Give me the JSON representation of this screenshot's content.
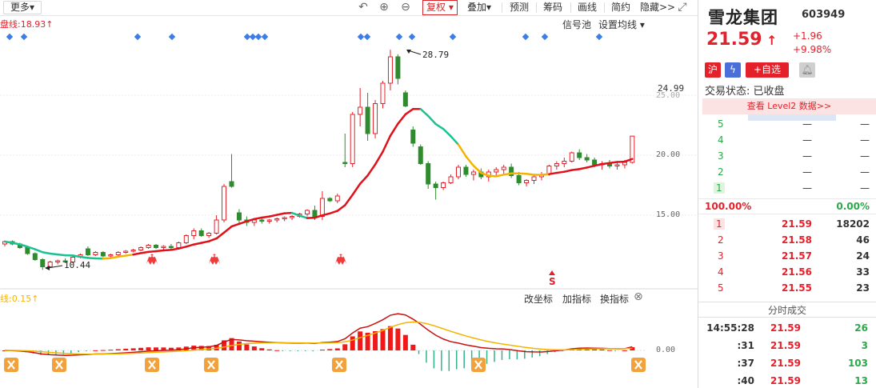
{
  "toolbar": {
    "more": "更多",
    "undo_icon": "undo-icon",
    "zoom_in_icon": "zoom-in-icon",
    "zoom_out_icon": "zoom-out-icon",
    "fuquan": "复权",
    "diejia": "叠加",
    "yuce": "预测",
    "chouma": "筹码",
    "huaxian": "画线",
    "jianyue": "简约",
    "hide": "隐藏>>"
  },
  "overlay": {
    "ma_label": "盘线:18.93",
    "signal_pool": "信号池",
    "set_ma": "设置均线",
    "high_label": "28.79",
    "low_label": "10.44",
    "s_mark": "S",
    "indicator_label": "线:0.15",
    "change_coord": "改坐标",
    "add_indicator": "加指标",
    "switch_indicator": "换指标"
  },
  "axis": {
    "last_close_tag": "24.99",
    "ticks": [
      "25.00",
      "20.00",
      "15.00"
    ],
    "macd_zero": "0.00"
  },
  "colors": {
    "up": "#e4212b",
    "down": "#2e8b2e",
    "ma_red": "#e0111b",
    "ma_green": "#1bc291",
    "ma_yellow": "#f3b400",
    "signal_blue": "#3d7de8"
  },
  "chart_data": {
    "type": "candlestick",
    "price_axis_ticks": [
      15,
      20,
      25
    ],
    "last_price_tag": 24.99,
    "high": 28.79,
    "low": 10.44,
    "candles": [
      [
        12.6,
        12.9,
        12.4,
        12.8
      ],
      [
        12.8,
        12.9,
        12.5,
        12.6
      ],
      [
        12.6,
        12.7,
        12.2,
        12.3
      ],
      [
        12.3,
        12.4,
        11.7,
        11.8
      ],
      [
        11.8,
        11.9,
        11.2,
        11.3
      ],
      [
        11.3,
        11.4,
        10.44,
        10.7
      ],
      [
        10.7,
        11.2,
        10.6,
        11.1
      ],
      [
        11.1,
        11.3,
        10.9,
        11.2
      ],
      [
        11.2,
        11.4,
        11.0,
        11.1
      ],
      [
        11.1,
        11.6,
        11.0,
        11.5
      ],
      [
        11.5,
        11.8,
        11.4,
        11.7
      ],
      [
        12.2,
        12.4,
        11.6,
        11.7
      ],
      [
        11.7,
        12.0,
        11.6,
        11.9
      ],
      [
        11.9,
        12.0,
        11.5,
        11.6
      ],
      [
        11.6,
        11.8,
        11.5,
        11.7
      ],
      [
        11.7,
        12.0,
        11.6,
        11.9
      ],
      [
        11.9,
        12.1,
        11.8,
        12.0
      ],
      [
        12.0,
        12.2,
        11.9,
        12.1
      ],
      [
        12.1,
        12.4,
        12.0,
        12.3
      ],
      [
        12.3,
        12.6,
        12.2,
        12.5
      ],
      [
        12.5,
        12.6,
        12.2,
        12.3
      ],
      [
        12.3,
        12.5,
        12.1,
        12.4
      ],
      [
        12.4,
        12.6,
        12.2,
        12.3
      ],
      [
        12.3,
        12.8,
        12.3,
        12.7
      ],
      [
        12.7,
        13.4,
        12.6,
        13.3
      ],
      [
        13.3,
        13.9,
        13.0,
        13.7
      ],
      [
        13.7,
        13.9,
        13.2,
        13.3
      ],
      [
        13.3,
        13.6,
        13.1,
        13.5
      ],
      [
        13.5,
        15.0,
        13.4,
        14.6
      ],
      [
        14.6,
        17.6,
        14.4,
        17.4
      ],
      [
        17.8,
        20.1,
        17.3,
        17.4
      ],
      [
        15.2,
        15.5,
        14.3,
        14.6
      ],
      [
        14.6,
        14.9,
        14.1,
        14.4
      ],
      [
        14.4,
        14.7,
        14.1,
        14.6
      ],
      [
        14.6,
        14.8,
        14.3,
        14.5
      ],
      [
        14.5,
        14.7,
        14.3,
        14.6
      ],
      [
        14.6,
        14.8,
        14.4,
        14.7
      ],
      [
        14.7,
        14.9,
        14.5,
        14.8
      ],
      [
        14.8,
        15.0,
        14.6,
        14.9
      ],
      [
        14.9,
        15.2,
        14.8,
        15.1
      ],
      [
        15.1,
        15.5,
        14.9,
        15.4
      ],
      [
        15.4,
        15.8,
        14.6,
        14.9
      ],
      [
        14.9,
        17.0,
        14.6,
        16.4
      ],
      [
        16.4,
        16.5,
        16.1,
        16.2
      ],
      [
        16.2,
        16.8,
        16.0,
        16.6
      ],
      [
        19.4,
        21.8,
        19.0,
        19.3
      ],
      [
        19.3,
        23.6,
        19.0,
        23.4
      ],
      [
        23.4,
        25.6,
        22.4,
        24.0
      ],
      [
        24.0,
        25.2,
        21.2,
        21.8
      ],
      [
        21.8,
        24.6,
        21.4,
        24.3
      ],
      [
        24.3,
        26.2,
        23.9,
        26.0
      ],
      [
        26.0,
        28.79,
        25.4,
        28.2
      ],
      [
        28.2,
        28.4,
        25.9,
        26.4
      ],
      [
        25.2,
        25.4,
        24.0,
        24.1
      ],
      [
        22.1,
        22.4,
        20.7,
        21.0
      ],
      [
        20.7,
        20.9,
        19.2,
        19.3
      ],
      [
        19.3,
        19.5,
        17.2,
        17.6
      ],
      [
        17.6,
        17.8,
        16.3,
        17.3
      ],
      [
        17.3,
        17.8,
        17.1,
        17.7
      ],
      [
        17.7,
        18.4,
        17.6,
        18.2
      ],
      [
        18.2,
        19.2,
        18.0,
        19.0
      ],
      [
        19.0,
        19.2,
        18.2,
        18.4
      ],
      [
        18.4,
        18.8,
        17.9,
        18.6
      ],
      [
        18.6,
        18.9,
        18.0,
        18.2
      ],
      [
        18.2,
        18.8,
        17.8,
        18.6
      ],
      [
        18.6,
        19.0,
        18.2,
        18.8
      ],
      [
        18.8,
        19.2,
        18.4,
        19.0
      ],
      [
        19.0,
        19.3,
        18.1,
        18.3
      ],
      [
        18.3,
        18.6,
        17.5,
        17.7
      ],
      [
        17.7,
        18.0,
        17.4,
        17.9
      ],
      [
        17.9,
        18.4,
        17.6,
        18.2
      ],
      [
        18.2,
        18.6,
        17.9,
        18.4
      ],
      [
        18.4,
        19.2,
        18.3,
        19.1
      ],
      [
        19.1,
        19.5,
        18.8,
        19.3
      ],
      [
        19.3,
        19.8,
        19.0,
        19.5
      ],
      [
        19.5,
        20.3,
        19.4,
        20.2
      ],
      [
        20.2,
        20.5,
        19.6,
        19.8
      ],
      [
        19.8,
        20.1,
        19.4,
        19.6
      ],
      [
        19.6,
        19.8,
        19.0,
        19.2
      ],
      [
        19.2,
        19.5,
        18.8,
        19.3
      ],
      [
        19.3,
        19.6,
        18.9,
        19.1
      ],
      [
        19.1,
        19.4,
        18.8,
        19.2
      ],
      [
        19.2,
        19.6,
        18.9,
        19.4
      ],
      [
        19.4,
        21.59,
        19.3,
        21.59
      ]
    ]
  },
  "quote": {
    "name": "雪龙集团",
    "code": "603949",
    "price": "21.59",
    "change": "+1.96",
    "change_pct": "+9.98%",
    "market_badge": "沪",
    "add_watch": "+自选",
    "trade_status": "交易状态: 已收盘",
    "level2": "查看 Level2 数据>>",
    "ask_dash": "—",
    "ratio_left": "100.00%",
    "ratio_right": "0.00%",
    "asks": [
      {
        "level": "5",
        "price": "—",
        "vol": "—"
      },
      {
        "level": "4",
        "price": "—",
        "vol": "—"
      },
      {
        "level": "3",
        "price": "—",
        "vol": "—"
      },
      {
        "level": "2",
        "price": "—",
        "vol": "—"
      },
      {
        "level": "1",
        "price": "—",
        "vol": "—"
      }
    ],
    "bids": [
      {
        "level": "1",
        "price": "21.59",
        "vol": "18202"
      },
      {
        "level": "2",
        "price": "21.58",
        "vol": "46"
      },
      {
        "level": "3",
        "price": "21.57",
        "vol": "24"
      },
      {
        "level": "4",
        "price": "21.56",
        "vol": "33"
      },
      {
        "level": "5",
        "price": "21.55",
        "vol": "23"
      }
    ],
    "tick_title": "分时成交",
    "ticks": [
      {
        "time": "14:55:28",
        "price": "21.59",
        "vol": "26"
      },
      {
        "time": ":31",
        "price": "21.59",
        "vol": "3"
      },
      {
        "time": ":37",
        "price": "21.59",
        "vol": "103"
      },
      {
        "time": ":40",
        "price": "21.59",
        "vol": "13"
      }
    ]
  }
}
